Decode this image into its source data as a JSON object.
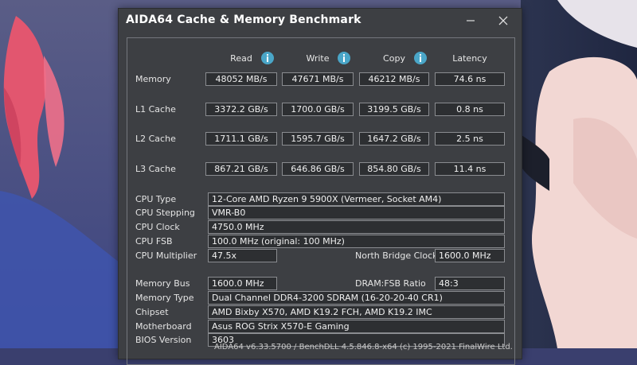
{
  "window": {
    "title": "AIDA64 Cache & Memory Benchmark",
    "minimize_icon": "minimize-icon",
    "close_icon": "close-icon"
  },
  "columns": {
    "read": "Read",
    "write": "Write",
    "copy": "Copy",
    "latency": "Latency"
  },
  "bench_rows": [
    {
      "label": "Memory",
      "read": "48052 MB/s",
      "write": "47671 MB/s",
      "copy": "46212 MB/s",
      "latency": "74.6 ns"
    },
    {
      "label": "L1 Cache",
      "read": "3372.2 GB/s",
      "write": "1700.0 GB/s",
      "copy": "3199.5 GB/s",
      "latency": "0.8 ns"
    },
    {
      "label": "L2 Cache",
      "read": "1711.1 GB/s",
      "write": "1595.7 GB/s",
      "copy": "1647.2 GB/s",
      "latency": "2.5 ns"
    },
    {
      "label": "L3 Cache",
      "read": "867.21 GB/s",
      "write": "646.86 GB/s",
      "copy": "854.80 GB/s",
      "latency": "11.4 ns"
    }
  ],
  "cpu": {
    "type_label": "CPU Type",
    "type": "12-Core AMD Ryzen 9 5900X  (Vermeer, Socket AM4)",
    "stepping_label": "CPU Stepping",
    "stepping": "VMR-B0",
    "clock_label": "CPU Clock",
    "clock": "4750.0 MHz",
    "fsb_label": "CPU FSB",
    "fsb": "100.0 MHz  (original: 100 MHz)",
    "multiplier_label": "CPU Multiplier",
    "multiplier": "47.5x",
    "nb_clock_label": "North Bridge Clock",
    "nb_clock": "1600.0 MHz"
  },
  "memory": {
    "bus_label": "Memory Bus",
    "bus": "1600.0 MHz",
    "ratio_label": "DRAM:FSB Ratio",
    "ratio": "48:3",
    "type_label": "Memory Type",
    "type": "Dual Channel DDR4-3200 SDRAM  (16-20-20-40 CR1)",
    "chipset_label": "Chipset",
    "chipset": "AMD Bixby X570, AMD K19.2 FCH, AMD K19.2 IMC",
    "motherboard_label": "Motherboard",
    "motherboard": "Asus ROG Strix X570-E Gaming",
    "bios_label": "BIOS Version",
    "bios": "3603"
  },
  "footer_text": "AIDA64 v6.33.5700 / BenchDLL 4.5.846.8-x64  (c) 1995-2021 FinalWire Ltd."
}
